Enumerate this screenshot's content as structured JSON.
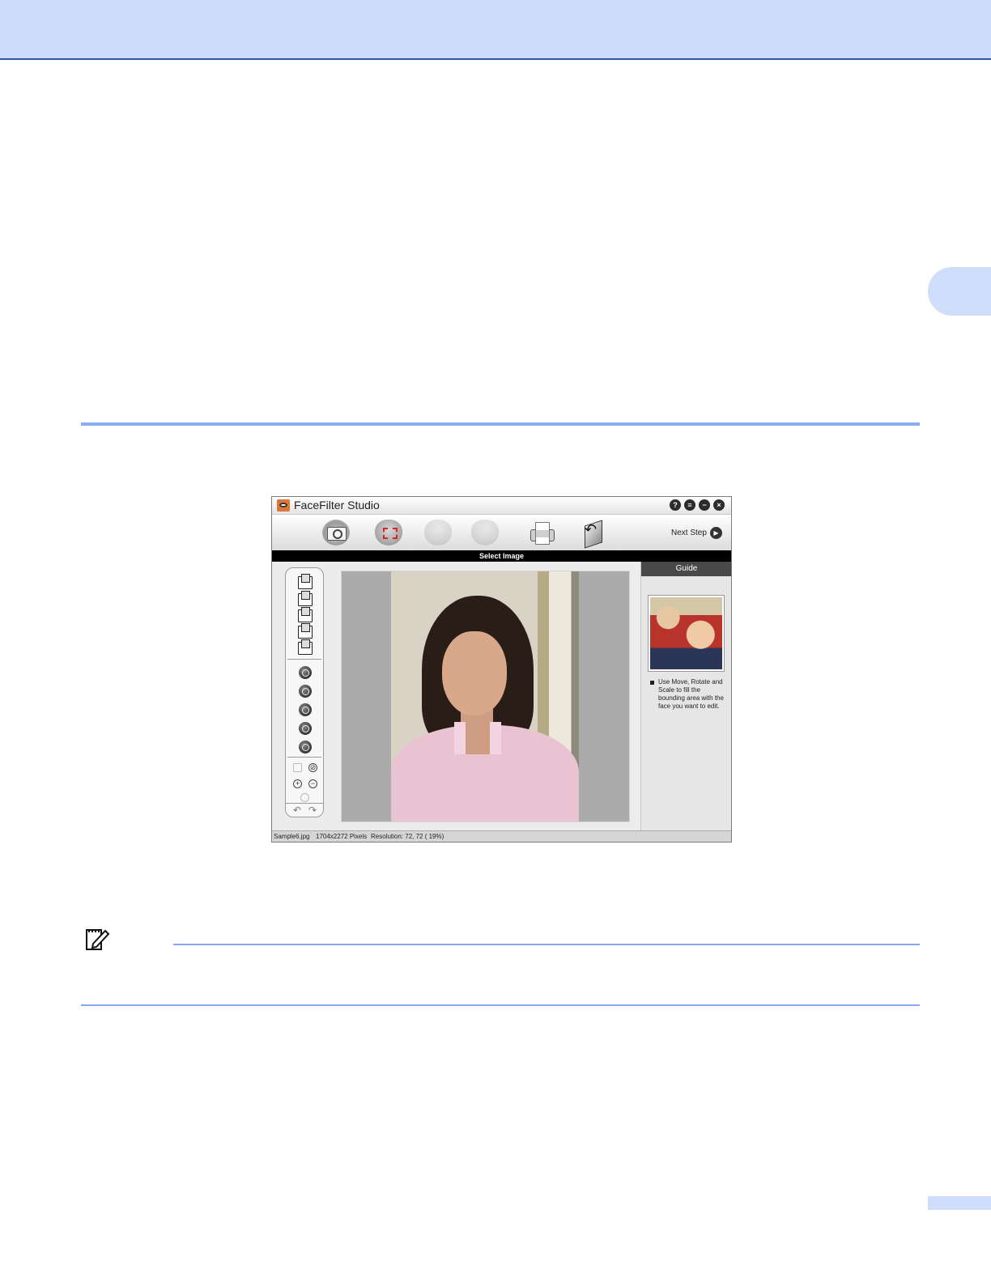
{
  "app": {
    "title": "FaceFilter Studio",
    "window_buttons": [
      "?",
      "≡",
      "−",
      "×"
    ],
    "toolbar": {
      "next_step_label": "Next Step",
      "icons": [
        "camera-icon",
        "face-select-icon",
        "face-edit-icon",
        "face-compare-icon",
        "printer-icon",
        "back-icon"
      ]
    },
    "step_title": "Select Image",
    "guide": {
      "header": "Guide",
      "text": "Use Move, Rotate and Scale to fill the bounding area with the face you want to edit."
    },
    "status": {
      "filename": "Sample6.jpg",
      "size": "1704x2272 Pixels",
      "resolution": "Resolution: 72, 72 ( 19%)"
    },
    "colors": {
      "header_band": "#ccdcfb",
      "accent_rule": "#8aaef0",
      "step_bar": "#000000",
      "guide_header": "#484848"
    }
  }
}
